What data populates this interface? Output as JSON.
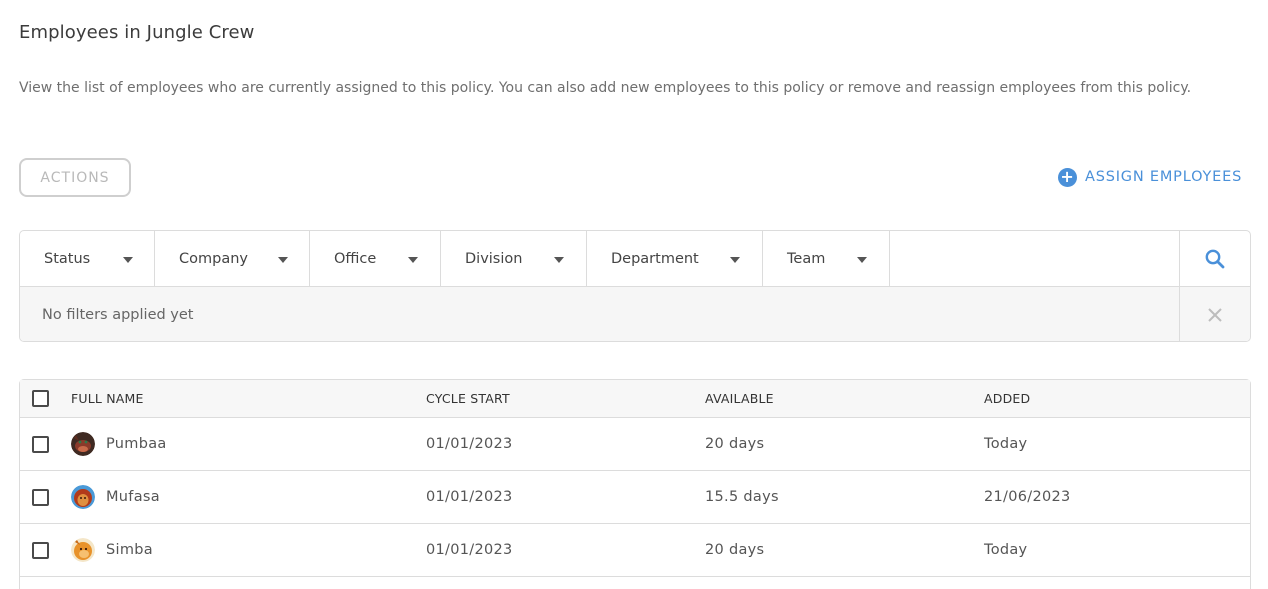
{
  "page": {
    "title": "Employees in Jungle Crew",
    "description": "View the list of employees who are currently assigned to this policy. You can also add new employees to this policy or remove and reassign employees from this policy."
  },
  "toolbar": {
    "actions_label": "ACTIONS",
    "assign_label": "ASSIGN EMPLOYEES"
  },
  "filters": {
    "items": [
      {
        "label": "Status"
      },
      {
        "label": "Company"
      },
      {
        "label": "Office"
      },
      {
        "label": "Division"
      },
      {
        "label": "Department"
      },
      {
        "label": "Team"
      }
    ],
    "status_text": "No filters applied yet"
  },
  "table": {
    "columns": [
      "FULL NAME",
      "CYCLE START",
      "AVAILABLE",
      "ADDED"
    ],
    "rows": [
      {
        "name": "Pumbaa",
        "cycle_start": "01/01/2023",
        "available": "20 days",
        "added": "Today",
        "avatar": "pumbaa-avatar"
      },
      {
        "name": "Mufasa",
        "cycle_start": "01/01/2023",
        "available": "15.5 days",
        "added": "21/06/2023",
        "avatar": "mufasa-avatar"
      },
      {
        "name": "Simba",
        "cycle_start": "01/01/2023",
        "available": "20 days",
        "added": "Today",
        "avatar": "simba-avatar"
      }
    ]
  },
  "colors": {
    "accent": "#4a90d9",
    "border": "#dcdcdc",
    "muted_bg": "#f6f6f6"
  }
}
